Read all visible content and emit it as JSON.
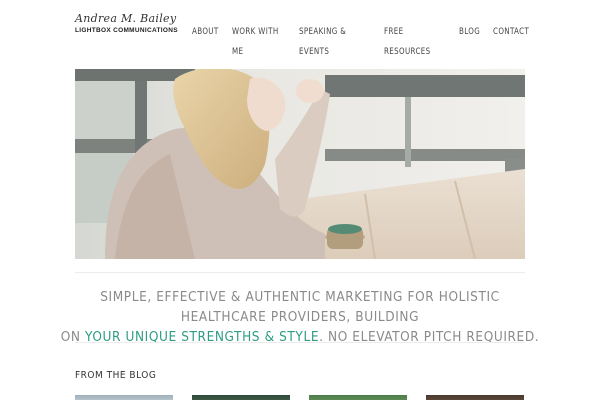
{
  "site": {
    "signature": "Andrea M. Bailey",
    "company": "LIGHTBOX COMMUNICATIONS"
  },
  "nav": {
    "items": [
      {
        "line1": "ABOUT",
        "line2": ""
      },
      {
        "line1": "WORK WITH",
        "line2": "ME"
      },
      {
        "line1": "SPEAKING &",
        "line2": "EVENTS"
      },
      {
        "line1": "FREE",
        "line2": "RESOURCES"
      },
      {
        "line1": "BLOG",
        "line2": ""
      },
      {
        "line1": "CONTACT",
        "line2": ""
      }
    ]
  },
  "tagline": {
    "line1": "SIMPLE, EFFECTIVE & AUTHENTIC MARKETING FOR HOLISTIC HEALTHCARE PROVIDERS, BUILDING",
    "pre": "ON ",
    "highlight": "YOUR UNIQUE STRENGTHS & STYLE",
    "post": ". NO ELEVATOR PITCH REQUIRED."
  },
  "blog": {
    "title": "FROM THE BLOG"
  },
  "colors": {
    "accent": "#2e9b83",
    "text_muted": "#8a8a8a"
  }
}
